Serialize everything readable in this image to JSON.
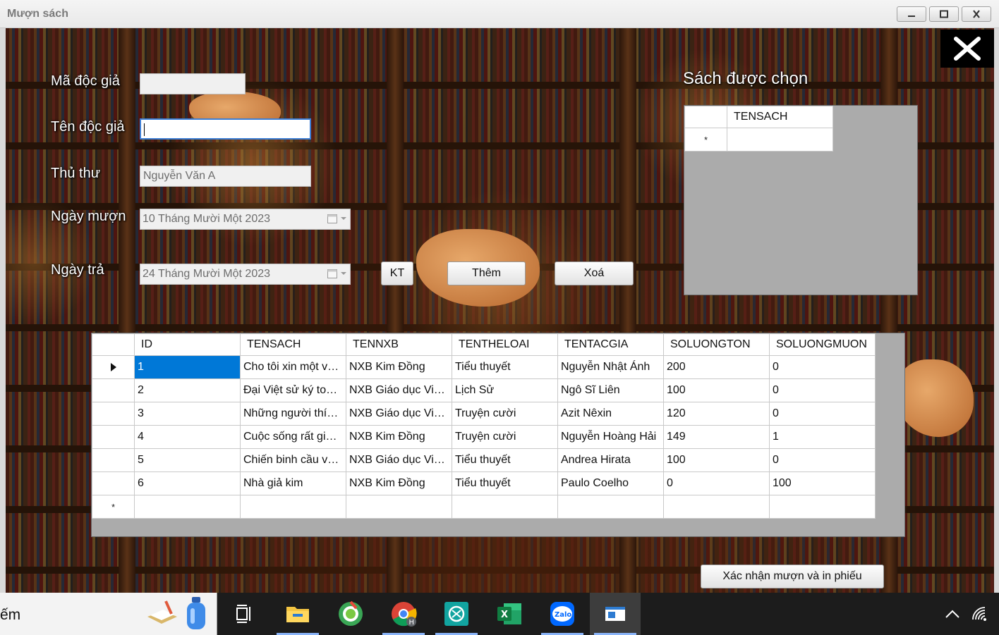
{
  "window": {
    "title": "Mượn sách"
  },
  "form": {
    "ma_doc_gia": {
      "label": "Mã độc giả",
      "value": ""
    },
    "ten_doc_gia": {
      "label": "Tên độc giả",
      "value": ""
    },
    "thu_thu": {
      "label": "Thủ thư",
      "value": "Nguyễn Văn A"
    },
    "ngay_muon": {
      "label": "Ngày mượn",
      "value": "10 Tháng Mười Một 2023"
    },
    "ngay_tra": {
      "label": "Ngày trả",
      "value": "24 Tháng Mười Một 2023"
    }
  },
  "buttons": {
    "kt": "KT",
    "them": "Thêm",
    "xoa": "Xoá",
    "confirm": "Xác nhận mượn và in phiếu"
  },
  "chosen": {
    "title": "Sách được chọn",
    "column": "TENSACH",
    "new_row_marker": "*"
  },
  "books_table": {
    "columns": [
      "ID",
      "TENSACH",
      "TENNXB",
      "TENTHELOAI",
      "TENTACGIA",
      "SOLUONGTON",
      "SOLUONGMUON"
    ],
    "rows": [
      [
        "1",
        "Cho tôi xin một vé đi tuổi thơ",
        "NXB Kim Đồng",
        "Tiểu thuyết",
        "Nguyễn Nhật Ánh",
        "200",
        "0"
      ],
      [
        "2",
        "Đại Việt sử ký toàn thư",
        "NXB Giáo dục Việt Nam",
        "Lịch Sử",
        "Ngô Sĩ Liên",
        "100",
        "0"
      ],
      [
        "3",
        "Những người thích đùa",
        "NXB Giáo dục Việt Nam",
        "Truyện cười",
        "Azit Nêxin",
        "120",
        "0"
      ],
      [
        "4",
        "Cuộc sống rất giống cuộc đời",
        "NXB Kim Đồng",
        "Truyện cười",
        "Nguyễn Hoàng Hải",
        "149",
        "1"
      ],
      [
        "5",
        "Chiến binh cầu vồng",
        "NXB Giáo dục Việt Nam",
        "Tiểu thuyết",
        "Andrea Hirata",
        "100",
        "0"
      ],
      [
        "6",
        "Nhà giả kim",
        "NXB Kim Đồng",
        "Tiểu thuyết",
        "Paulo Coelho",
        "0",
        "100"
      ]
    ],
    "selected_row": 0,
    "new_row_marker": "*"
  },
  "taskbar": {
    "search_text": "ếm",
    "apps": [
      "task-view",
      "file-explorer",
      "coccoc",
      "chrome",
      "chatgpt",
      "excel",
      "zalo",
      "winforms-app"
    ],
    "zalo_label": "Zalo",
    "excel_label": "X"
  },
  "colors": {
    "selection": "#0078d7",
    "grid_bg": "#ababab",
    "focus_border": "#3d7fd6"
  }
}
